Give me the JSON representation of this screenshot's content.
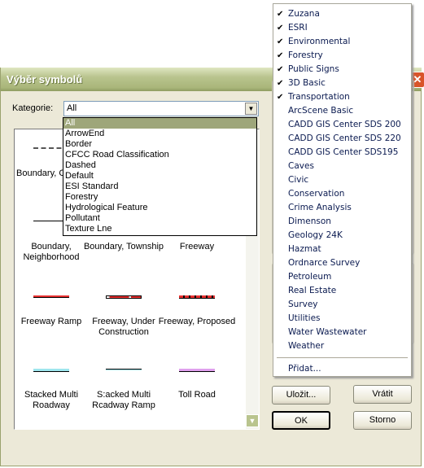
{
  "dialog": {
    "title": "Výběr symbolů",
    "category_label": "Kategorie:",
    "category_value": "All"
  },
  "category_options": [
    "All",
    "ArrowEnd",
    "Border",
    "CFCC Road Classification",
    "Dashed",
    "Default",
    "ESI Standard",
    "Forestry",
    "Hydrological Feature",
    "Pollutant",
    "Texture Lne"
  ],
  "symbols": [
    {
      "label": "Boundary, C",
      "colors": [
        "#555555"
      ]
    },
    {
      "label": "Boundary, Neighborhood",
      "colors": [
        "#000000"
      ]
    },
    {
      "label": "Boundary, Township",
      "colors": [
        "#000000"
      ]
    },
    {
      "label": "Freeway",
      "colors": [
        "#000000"
      ]
    },
    {
      "label": "Freeway Ramp",
      "colors": [
        "#e83030",
        "#000000"
      ]
    },
    {
      "label": "Freeway, Under Construction",
      "colors": [
        "#e83030",
        "#000000"
      ]
    },
    {
      "label": "Freeway, Proposed",
      "colors": [
        "#e83030",
        "#000000"
      ]
    },
    {
      "label": "Stacked Multi Roadway",
      "colors": [
        "#9ee6ee",
        "#000000"
      ]
    },
    {
      "label": "S:acked Multi Rcadway Ramp",
      "colors": [
        "#9ee6ee",
        "#000000"
      ]
    },
    {
      "label": "Toll Road",
      "colors": [
        "#e0a0ee",
        "#000000"
      ]
    }
  ],
  "buttons": {
    "save": "Uložit...",
    "reset": "Vrátit",
    "ok": "OK",
    "cancel": "Storno"
  },
  "menu": {
    "items": [
      {
        "label": "Zuzana",
        "checked": true
      },
      {
        "label": "ESRI",
        "checked": true
      },
      {
        "label": "Environmental",
        "checked": true
      },
      {
        "label": "Forestry",
        "checked": true
      },
      {
        "label": "Public Signs",
        "checked": true
      },
      {
        "label": "3D Basic",
        "checked": true
      },
      {
        "label": "Transportation",
        "checked": true
      },
      {
        "label": "ArcScene Basic",
        "checked": false
      },
      {
        "label": "CADD GIS Center SDS 200",
        "checked": false
      },
      {
        "label": "CADD GIS Center SDS 220",
        "checked": false
      },
      {
        "label": "CADD GIS Center SDS195",
        "checked": false
      },
      {
        "label": "Caves",
        "checked": false
      },
      {
        "label": "Civic",
        "checked": false
      },
      {
        "label": "Conservation",
        "checked": false
      },
      {
        "label": "Crime Analysis",
        "checked": false
      },
      {
        "label": "Dimenson",
        "checked": false
      },
      {
        "label": "Geology 24K",
        "checked": false
      },
      {
        "label": "Hazmat",
        "checked": false
      },
      {
        "label": "Ordnarce Survey",
        "checked": false
      },
      {
        "label": "Petroleum",
        "checked": false
      },
      {
        "label": "Real Estate",
        "checked": false
      },
      {
        "label": "Survey",
        "checked": false
      },
      {
        "label": "Utilities",
        "checked": false
      },
      {
        "label": "Water Wastewater",
        "checked": false
      },
      {
        "label": "Weather",
        "checked": false
      }
    ],
    "add": "Přidat...",
    "check_glyph": "✔"
  },
  "icons": {
    "close": "close-icon",
    "dropdown": "chevron-down-icon",
    "scroll_down": "scroll-down-icon"
  }
}
